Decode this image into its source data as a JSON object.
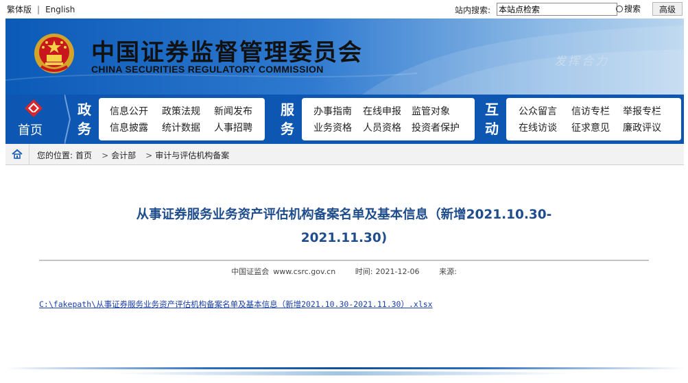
{
  "topbar": {
    "lang_traditional": "繁体版",
    "lang_separator": "|",
    "lang_english": "English",
    "search_label": "站内搜索:",
    "search_value": "本站点检索",
    "search_button": "搜索",
    "advanced_button": "高级"
  },
  "banner": {
    "title_cn": "中国证券监督管理委员会",
    "title_en": "CHINA SECURITIES REGULATORY COMMISSION",
    "slogan": "发挥合力"
  },
  "nav": {
    "home_label": "首页",
    "groups": [
      {
        "title_1": "政",
        "title_2": "务",
        "items": [
          "信息公开",
          "政策法规",
          "新闻发布",
          "信息披露",
          "统计数据",
          "人事招聘"
        ]
      },
      {
        "title_1": "服",
        "title_2": "务",
        "items": [
          "办事指南",
          "在线申报",
          "监管对象",
          "业务资格",
          "人员资格",
          "投资者保护"
        ]
      },
      {
        "title_1": "互",
        "title_2": "动",
        "items": [
          "公众留言",
          "信访专栏",
          "举报专栏",
          "在线访谈",
          "征求意见",
          "廉政评议"
        ]
      }
    ]
  },
  "breadcrumb": {
    "prefix": "您的位置:",
    "items": [
      "首页",
      "会计部",
      "审计与评估机构备案"
    ]
  },
  "article": {
    "title_line1": "从事证券服务业务资产评估机构备案名单及基本信息（新增2021.10.30-",
    "title_line2": "2021.11.30)",
    "source": "中国证监会",
    "site": "www.csrc.gov.cn",
    "time_label": "时间:",
    "time_value": "2021-12-06",
    "origin_label": "来源:",
    "attachment": "C:\\fakepath\\从事证券服务业务资产评估机构备案名单及基本信息（新增2021.10.30-2021.11.30）.xlsx"
  },
  "colors": {
    "nav_blue": "#0d57b3",
    "title_blue": "#1f4d8c",
    "link_blue": "#1a3fa8"
  }
}
